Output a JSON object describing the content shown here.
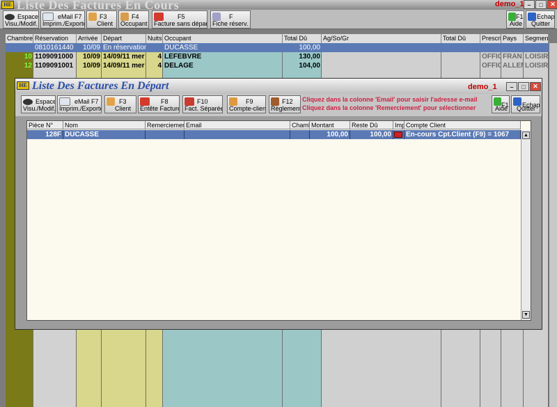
{
  "main": {
    "title": "Liste Des Factures En Cours",
    "user": "demo_1",
    "toolbar": [
      {
        "key": "Espace",
        "label": "Visu./Modif."
      },
      {
        "key": "eMail F7",
        "label": "Imprim./Exporte"
      },
      {
        "key": "F3",
        "label": "Client"
      },
      {
        "key": "F4",
        "label": "Occupant"
      },
      {
        "key": "F5",
        "label": "Facture sans départ"
      },
      {
        "key": "F",
        "label": "Fiche réserv."
      },
      {
        "key": "F1",
        "label": "Aide"
      },
      {
        "key": "Echap",
        "label": "Quitter"
      }
    ],
    "headers": [
      "Chambre",
      "Réservation",
      "Arrivée",
      "Départ",
      "Nuits",
      "Occupant",
      "Total Dû",
      "Ag/So/Gr",
      "Total Dû",
      "Prescri",
      "Pays",
      "Segmen"
    ],
    "rows": [
      {
        "chambre": "",
        "reservation": "0810161440",
        "arrivee": "10/09",
        "depart": "En réservation",
        "nuits": "",
        "occupant": "DUCASSE",
        "total": "100,00",
        "prescri": "",
        "pays": "",
        "segment": ""
      },
      {
        "chambre": "10",
        "reservation": "1109091000",
        "arrivee": "10/09",
        "depart": "14/09/11 mer",
        "nuits": "4",
        "occupant": "LEFEBVRE",
        "total": "130,00",
        "prescri": "OFFIC",
        "pays": "FRAN",
        "segment": "LOISIR"
      },
      {
        "chambre": "12",
        "reservation": "1109091001",
        "arrivee": "10/09",
        "depart": "14/09/11 mer",
        "nuits": "4",
        "occupant": "DELAGE",
        "total": "104,00",
        "prescri": "OFFIC",
        "pays": "ALLEM",
        "segment": "LOISIR"
      }
    ]
  },
  "modal": {
    "title": "Liste Des Factures En Départ",
    "user": "demo_1",
    "toolbar": [
      {
        "key": "Espace",
        "label": "Visu./Modif."
      },
      {
        "key": "eMail F7",
        "label": "Imprim./Exporte"
      },
      {
        "key": "F3",
        "label": "Client"
      },
      {
        "key": "F8",
        "label": "Entête Facture"
      },
      {
        "key": "F10",
        "label": "Fact. Séparée"
      },
      {
        "key": "F9",
        "label": "Compte-client"
      },
      {
        "key": "F12",
        "label": "Règlement"
      },
      {
        "key": "F1",
        "label": "Aide"
      },
      {
        "key": "Echap",
        "label": "Quitter"
      }
    ],
    "notice1": "Cliquez dans la colonne 'Email' pour saisir l'adresse e-mail",
    "notice2": "Cliquez dans la colonne 'Remerciement' pour sélectionner",
    "headers": [
      "Pièce N°",
      "Nom",
      "Remerciement",
      "Email",
      "Chambr",
      "Montant",
      "Reste Dû",
      "Imp",
      "Compte Client"
    ],
    "row": {
      "piece": "128F",
      "nom": "DUCASSE",
      "remerciement": "",
      "email": "",
      "chambre": "",
      "montant": "100,00",
      "reste": "100,00",
      "compte": "En-cours Cpt.Client (F9) = 1067"
    }
  }
}
